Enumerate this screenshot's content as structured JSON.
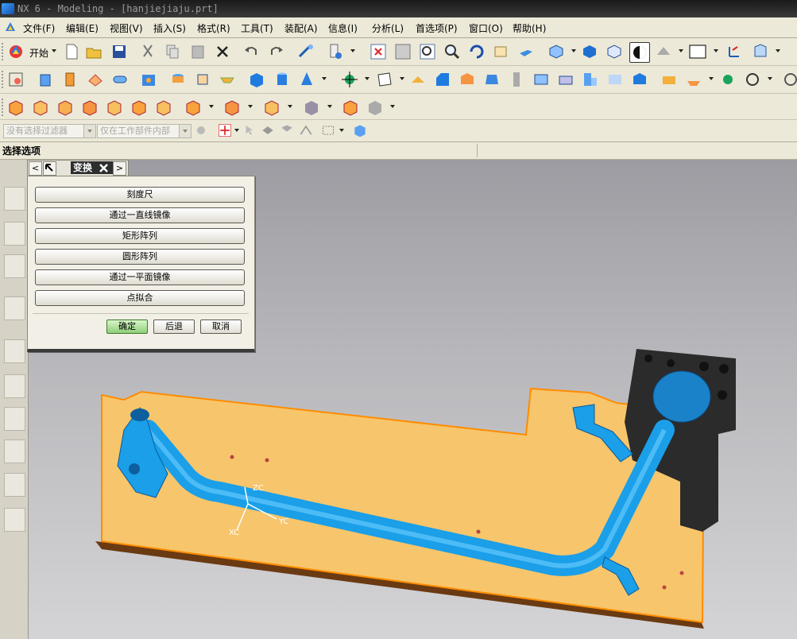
{
  "window": {
    "title": "NX 6 - Modeling - [hanjiejiaju.prt]"
  },
  "menubar": {
    "items": [
      "文件(F)",
      "编辑(E)",
      "视图(V)",
      "插入(S)",
      "格式(R)",
      "工具(T)",
      "装配(A)",
      "信息(I)",
      "分析(L)",
      "首选项(P)",
      "窗口(O)",
      "帮助(H)"
    ]
  },
  "toolbar": {
    "start_label": "开始"
  },
  "selection_bar": {
    "filter_placeholder": "没有选择过滤器",
    "scope_placeholder": "仅在工作部件内部"
  },
  "cue_line": {
    "label": "选择选项"
  },
  "dialog": {
    "title": "变换",
    "nav_prev": "<",
    "nav_next": ">",
    "options": [
      "刻度尺",
      "通过一直线镜像",
      "矩形阵列",
      "圆形阵列",
      "通过一平面镜像",
      "点拟合"
    ],
    "ok_label": "确定",
    "back_label": "后退",
    "cancel_label": "取消"
  },
  "viewport": {
    "axis_label_yc": "YC",
    "axis_label_zc": "ZC",
    "axis_label_xc": "XC"
  },
  "colors": {
    "fixture_plate": "#f7c56b",
    "plate_edge": "#ff8c00",
    "tube": "#1a9fe8",
    "block": "#2b2b2b"
  }
}
